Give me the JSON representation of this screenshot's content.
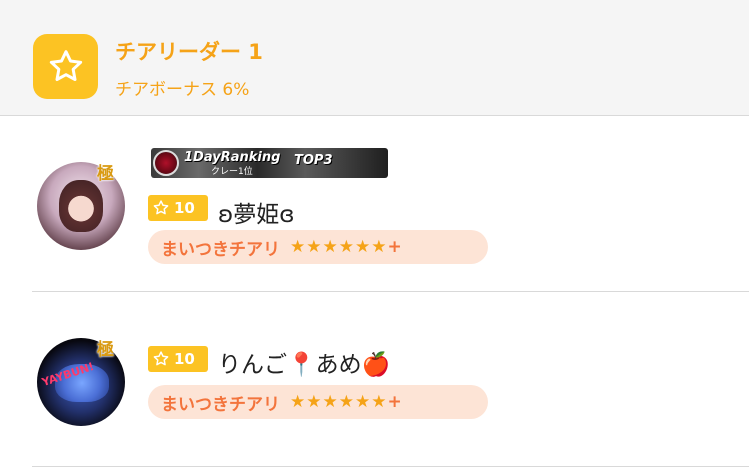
{
  "header": {
    "rank_title": "チアリーダー 1",
    "bonus_text": "チアボーナス 6%"
  },
  "users": [
    {
      "kiwami": "極",
      "ranking_banner": {
        "text": "1DayRanking",
        "sub": "クレー1位",
        "top": "TOP3"
      },
      "level": "10",
      "name": "ʚ夢姫ɞ",
      "cheer_label": "まいつきチアリ",
      "cheer_stars": "★★★★★★",
      "cheer_plus": "+"
    },
    {
      "kiwami": "極",
      "avatar_text": "YAYBUN!",
      "level": "10",
      "name": "りんご📍あめ🍎",
      "cheer_label": "まいつきチアリ",
      "cheer_stars": "★★★★★★",
      "cheer_plus": "+"
    }
  ],
  "icons": {
    "rank": "star-outline-icon",
    "level": "star-outline-icon"
  },
  "colors": {
    "accent_yellow": "#fcc323",
    "title_orange": "#f5a318",
    "cheer_orange": "#f3743c",
    "cheer_bg": "#fde4d6"
  }
}
